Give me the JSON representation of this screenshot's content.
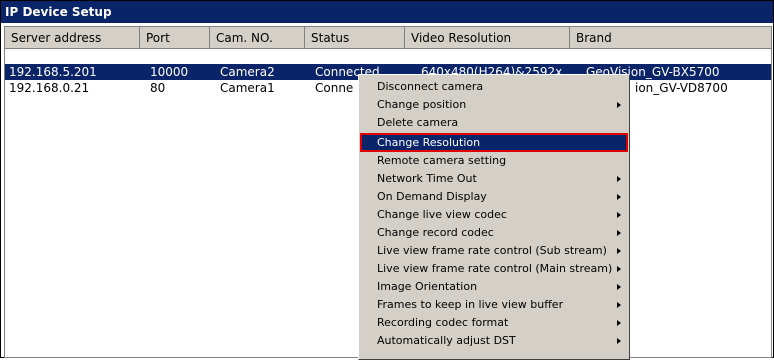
{
  "window": {
    "title": "IP Device Setup"
  },
  "columns": [
    "Server address",
    "Port",
    "Cam. NO.",
    "Status",
    "Video Resolution",
    "Brand"
  ],
  "rows": [
    {
      "server": "192.168.5.201",
      "port": "10000",
      "cam": "Camera2",
      "status": "Connected",
      "resolution": "640x480(H264)&2592x",
      "brand": "GeoVision_GV-BX5700",
      "selected": true
    },
    {
      "server": "192.168.0.21",
      "port": "80",
      "cam": "Camera1",
      "status": "Conne",
      "resolution": "",
      "brand": "ion_GV-VD8700",
      "selected": false
    }
  ],
  "context_menu": {
    "items": [
      {
        "label": "Disconnect camera",
        "submenu": false
      },
      {
        "label": "Change position",
        "submenu": true
      },
      {
        "label": "Delete camera",
        "submenu": false
      },
      {
        "label": "Change Resolution",
        "submenu": false,
        "highlighted": true
      },
      {
        "label": "Remote camera setting",
        "submenu": false
      },
      {
        "label": "Network Time Out",
        "submenu": true
      },
      {
        "label": "On Demand Display",
        "submenu": true
      },
      {
        "label": "Change live view codec",
        "submenu": true
      },
      {
        "label": "Change record codec",
        "submenu": true
      },
      {
        "label": "Live view frame rate control (Sub stream)",
        "submenu": true
      },
      {
        "label": "Live view frame rate control (Main stream)",
        "submenu": true
      },
      {
        "label": "Image Orientation",
        "submenu": true
      },
      {
        "label": "Frames to keep in live view buffer",
        "submenu": true
      },
      {
        "label": "Recording codec format",
        "submenu": true
      },
      {
        "label": "Automatically adjust DST",
        "submenu": true
      }
    ]
  },
  "colors": {
    "title_bg": "#0a246a",
    "selection": "#0a246a",
    "highlight_border": "#e00000",
    "menu_bg": "#d4d0c8"
  }
}
